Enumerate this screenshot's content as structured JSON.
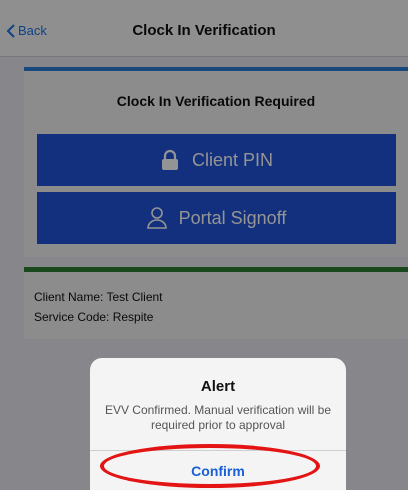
{
  "nav": {
    "back_label": "Back",
    "title": "Clock In Verification"
  },
  "verification_card": {
    "title": "Clock In Verification Required",
    "client_pin_label": "Client PIN",
    "portal_signoff_label": "Portal Signoff"
  },
  "client_card": {
    "client_name": "Client Name: Test Client",
    "service_code": "Service Code: Respite"
  },
  "alert": {
    "title": "Alert",
    "message": "EVV Confirmed. Manual verification will be required prior to approval",
    "confirm_label": "Confirm"
  },
  "colors": {
    "primary_button": "#1f54d8",
    "link_blue": "#1a73e8",
    "card_top_blue": "#2a7bd8",
    "card_top_green": "#2e7d32",
    "highlight_red": "#e41414"
  },
  "icons": {
    "back": "chevron-left-icon",
    "client_pin": "lock-icon",
    "portal_signoff": "person-icon"
  }
}
